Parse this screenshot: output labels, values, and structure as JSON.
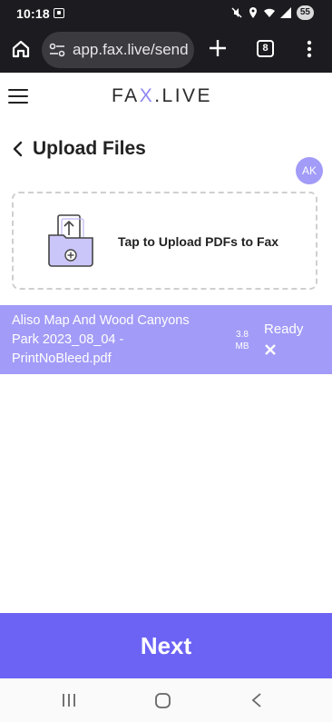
{
  "status_bar": {
    "time": "10:18",
    "battery": "55",
    "icons": [
      "screenshot-icon",
      "mute-icon",
      "location-icon",
      "wifi-icon",
      "signal-icon",
      "battery-icon"
    ]
  },
  "browser": {
    "url": "app.fax.live/send",
    "tab_count": "8",
    "icons": [
      "home-icon",
      "site-info-icon",
      "new-tab-icon",
      "tab-switcher-icon",
      "overflow-menu-icon"
    ]
  },
  "header": {
    "logo_left": "FA",
    "logo_x": "X",
    "logo_right": ".LIVE",
    "avatar_initials": "AK",
    "accent_color": "#8f87f2"
  },
  "page": {
    "title": "Upload Files"
  },
  "upload": {
    "label": "Tap to Upload PDFs to Fax"
  },
  "files": [
    {
      "name": "Aliso Map And Wood Canyons Park 2023_08_04 - PrintNoBleed.pdf",
      "size_value": "3.8",
      "size_unit": "MB",
      "status": "Ready",
      "row_color": "#a29bf7"
    }
  ],
  "footer": {
    "next_label": "Next",
    "button_color": "#6c63f5"
  },
  "nav": {
    "icons": [
      "recent-apps-icon",
      "home-button-icon",
      "back-button-icon"
    ]
  }
}
